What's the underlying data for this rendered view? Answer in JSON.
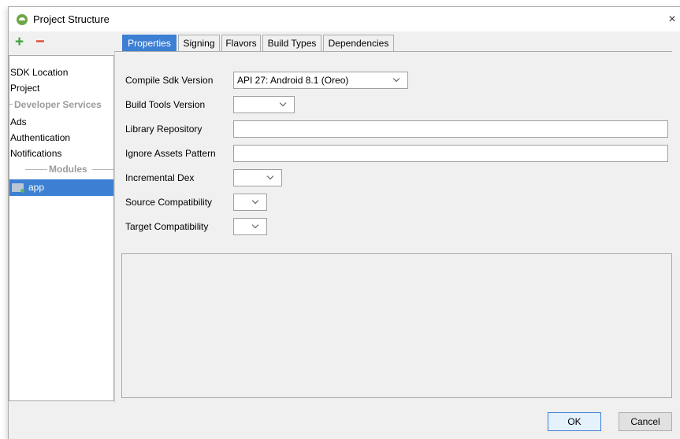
{
  "window": {
    "title": "Project Structure",
    "close_label": "×"
  },
  "sidebar": {
    "add_label": "+",
    "remove_label": "−",
    "items": [
      {
        "label": "SDK Location",
        "type": "item"
      },
      {
        "label": "Project",
        "type": "item"
      },
      {
        "label": "Developer Services",
        "type": "header"
      },
      {
        "label": "Ads",
        "type": "item"
      },
      {
        "label": "Authentication",
        "type": "item"
      },
      {
        "label": "Notifications",
        "type": "item"
      },
      {
        "label": "Modules",
        "type": "separator"
      },
      {
        "label": "app",
        "type": "module",
        "selected": true
      }
    ]
  },
  "tabs": [
    {
      "label": "Properties",
      "active": true
    },
    {
      "label": "Signing",
      "active": false
    },
    {
      "label": "Flavors",
      "active": false
    },
    {
      "label": "Build Types",
      "active": false
    },
    {
      "label": "Dependencies",
      "active": false
    }
  ],
  "form": {
    "compile_sdk": {
      "label": "Compile Sdk Version",
      "value": "API 27: Android 8.1 (Oreo)"
    },
    "build_tools": {
      "label": "Build Tools Version",
      "value": ""
    },
    "library_repo": {
      "label": "Library Repository",
      "value": ""
    },
    "ignore_assets": {
      "label": "Ignore Assets Pattern",
      "value": ""
    },
    "incremental_dex": {
      "label": "Incremental Dex",
      "value": ""
    },
    "source_compat": {
      "label": "Source Compatibility",
      "value": ""
    },
    "target_compat": {
      "label": "Target Compatibility",
      "value": ""
    }
  },
  "footer": {
    "ok_label": "OK",
    "cancel_label": "Cancel"
  },
  "colors": {
    "accent": "#3d7fd3",
    "add_green": "#3aa03a",
    "remove_red": "#d9442e"
  }
}
